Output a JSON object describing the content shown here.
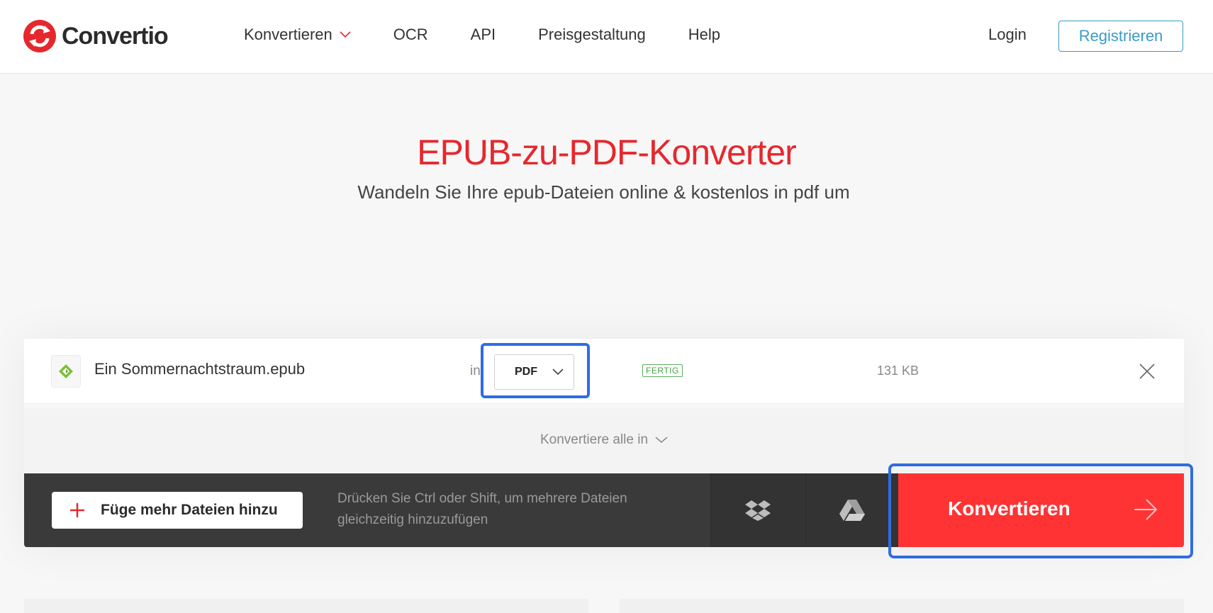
{
  "brand": {
    "name": "Convertio",
    "color": "#e5282d"
  },
  "nav": {
    "items": [
      {
        "label": "Konvertieren",
        "has_dropdown": true
      },
      {
        "label": "OCR"
      },
      {
        "label": "API"
      },
      {
        "label": "Preisgestaltung"
      },
      {
        "label": "Help"
      }
    ],
    "login": "Login",
    "register": "Registrieren"
  },
  "hero": {
    "title": "EPUB-zu-PDF-Konverter",
    "subtitle": "Wandeln Sie Ihre epub-Dateien online & kostenlos in pdf um"
  },
  "file": {
    "name": "Ein Sommernachtstraum.epub",
    "in_label": "in",
    "format": "PDF",
    "status": "FERTIG",
    "size": "131 KB",
    "icon": "epub-icon"
  },
  "convert_all": {
    "label": "Konvertiere alle in"
  },
  "actions": {
    "add_files": "Füge mehr Dateien hinzu",
    "hint": "Drücken Sie Ctrl oder Shift, um mehrere Dateien gleichzeitig hinzuzufügen",
    "dropbox_icon": "dropbox-icon",
    "gdrive_icon": "google-drive-icon",
    "convert": "Konvertieren"
  },
  "colors": {
    "accent": "#ff3333",
    "highlight": "#2f6de1",
    "register": "#3a9cc4",
    "status": "#4a9e4a"
  }
}
